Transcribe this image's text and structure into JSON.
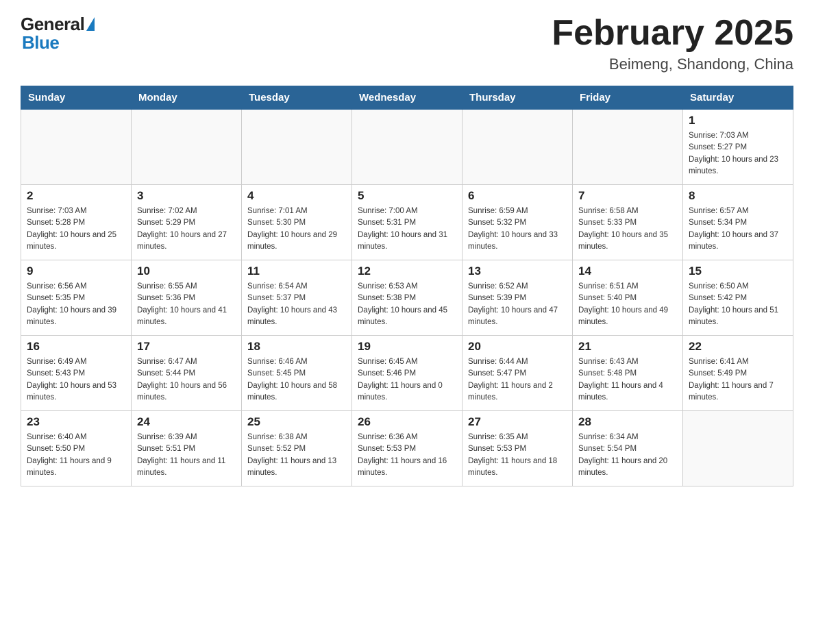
{
  "header": {
    "logo": {
      "general": "General",
      "blue": "Blue",
      "tagline": "GeneralBlue"
    },
    "title": "February 2025",
    "subtitle": "Beimeng, Shandong, China"
  },
  "weekdays": [
    "Sunday",
    "Monday",
    "Tuesday",
    "Wednesday",
    "Thursday",
    "Friday",
    "Saturday"
  ],
  "weeks": [
    [
      {
        "day": "",
        "sunrise": "",
        "sunset": "",
        "daylight": ""
      },
      {
        "day": "",
        "sunrise": "",
        "sunset": "",
        "daylight": ""
      },
      {
        "day": "",
        "sunrise": "",
        "sunset": "",
        "daylight": ""
      },
      {
        "day": "",
        "sunrise": "",
        "sunset": "",
        "daylight": ""
      },
      {
        "day": "",
        "sunrise": "",
        "sunset": "",
        "daylight": ""
      },
      {
        "day": "",
        "sunrise": "",
        "sunset": "",
        "daylight": ""
      },
      {
        "day": "1",
        "sunrise": "Sunrise: 7:03 AM",
        "sunset": "Sunset: 5:27 PM",
        "daylight": "Daylight: 10 hours and 23 minutes."
      }
    ],
    [
      {
        "day": "2",
        "sunrise": "Sunrise: 7:03 AM",
        "sunset": "Sunset: 5:28 PM",
        "daylight": "Daylight: 10 hours and 25 minutes."
      },
      {
        "day": "3",
        "sunrise": "Sunrise: 7:02 AM",
        "sunset": "Sunset: 5:29 PM",
        "daylight": "Daylight: 10 hours and 27 minutes."
      },
      {
        "day": "4",
        "sunrise": "Sunrise: 7:01 AM",
        "sunset": "Sunset: 5:30 PM",
        "daylight": "Daylight: 10 hours and 29 minutes."
      },
      {
        "day": "5",
        "sunrise": "Sunrise: 7:00 AM",
        "sunset": "Sunset: 5:31 PM",
        "daylight": "Daylight: 10 hours and 31 minutes."
      },
      {
        "day": "6",
        "sunrise": "Sunrise: 6:59 AM",
        "sunset": "Sunset: 5:32 PM",
        "daylight": "Daylight: 10 hours and 33 minutes."
      },
      {
        "day": "7",
        "sunrise": "Sunrise: 6:58 AM",
        "sunset": "Sunset: 5:33 PM",
        "daylight": "Daylight: 10 hours and 35 minutes."
      },
      {
        "day": "8",
        "sunrise": "Sunrise: 6:57 AM",
        "sunset": "Sunset: 5:34 PM",
        "daylight": "Daylight: 10 hours and 37 minutes."
      }
    ],
    [
      {
        "day": "9",
        "sunrise": "Sunrise: 6:56 AM",
        "sunset": "Sunset: 5:35 PM",
        "daylight": "Daylight: 10 hours and 39 minutes."
      },
      {
        "day": "10",
        "sunrise": "Sunrise: 6:55 AM",
        "sunset": "Sunset: 5:36 PM",
        "daylight": "Daylight: 10 hours and 41 minutes."
      },
      {
        "day": "11",
        "sunrise": "Sunrise: 6:54 AM",
        "sunset": "Sunset: 5:37 PM",
        "daylight": "Daylight: 10 hours and 43 minutes."
      },
      {
        "day": "12",
        "sunrise": "Sunrise: 6:53 AM",
        "sunset": "Sunset: 5:38 PM",
        "daylight": "Daylight: 10 hours and 45 minutes."
      },
      {
        "day": "13",
        "sunrise": "Sunrise: 6:52 AM",
        "sunset": "Sunset: 5:39 PM",
        "daylight": "Daylight: 10 hours and 47 minutes."
      },
      {
        "day": "14",
        "sunrise": "Sunrise: 6:51 AM",
        "sunset": "Sunset: 5:40 PM",
        "daylight": "Daylight: 10 hours and 49 minutes."
      },
      {
        "day": "15",
        "sunrise": "Sunrise: 6:50 AM",
        "sunset": "Sunset: 5:42 PM",
        "daylight": "Daylight: 10 hours and 51 minutes."
      }
    ],
    [
      {
        "day": "16",
        "sunrise": "Sunrise: 6:49 AM",
        "sunset": "Sunset: 5:43 PM",
        "daylight": "Daylight: 10 hours and 53 minutes."
      },
      {
        "day": "17",
        "sunrise": "Sunrise: 6:47 AM",
        "sunset": "Sunset: 5:44 PM",
        "daylight": "Daylight: 10 hours and 56 minutes."
      },
      {
        "day": "18",
        "sunrise": "Sunrise: 6:46 AM",
        "sunset": "Sunset: 5:45 PM",
        "daylight": "Daylight: 10 hours and 58 minutes."
      },
      {
        "day": "19",
        "sunrise": "Sunrise: 6:45 AM",
        "sunset": "Sunset: 5:46 PM",
        "daylight": "Daylight: 11 hours and 0 minutes."
      },
      {
        "day": "20",
        "sunrise": "Sunrise: 6:44 AM",
        "sunset": "Sunset: 5:47 PM",
        "daylight": "Daylight: 11 hours and 2 minutes."
      },
      {
        "day": "21",
        "sunrise": "Sunrise: 6:43 AM",
        "sunset": "Sunset: 5:48 PM",
        "daylight": "Daylight: 11 hours and 4 minutes."
      },
      {
        "day": "22",
        "sunrise": "Sunrise: 6:41 AM",
        "sunset": "Sunset: 5:49 PM",
        "daylight": "Daylight: 11 hours and 7 minutes."
      }
    ],
    [
      {
        "day": "23",
        "sunrise": "Sunrise: 6:40 AM",
        "sunset": "Sunset: 5:50 PM",
        "daylight": "Daylight: 11 hours and 9 minutes."
      },
      {
        "day": "24",
        "sunrise": "Sunrise: 6:39 AM",
        "sunset": "Sunset: 5:51 PM",
        "daylight": "Daylight: 11 hours and 11 minutes."
      },
      {
        "day": "25",
        "sunrise": "Sunrise: 6:38 AM",
        "sunset": "Sunset: 5:52 PM",
        "daylight": "Daylight: 11 hours and 13 minutes."
      },
      {
        "day": "26",
        "sunrise": "Sunrise: 6:36 AM",
        "sunset": "Sunset: 5:53 PM",
        "daylight": "Daylight: 11 hours and 16 minutes."
      },
      {
        "day": "27",
        "sunrise": "Sunrise: 6:35 AM",
        "sunset": "Sunset: 5:53 PM",
        "daylight": "Daylight: 11 hours and 18 minutes."
      },
      {
        "day": "28",
        "sunrise": "Sunrise: 6:34 AM",
        "sunset": "Sunset: 5:54 PM",
        "daylight": "Daylight: 11 hours and 20 minutes."
      },
      {
        "day": "",
        "sunrise": "",
        "sunset": "",
        "daylight": ""
      }
    ]
  ]
}
